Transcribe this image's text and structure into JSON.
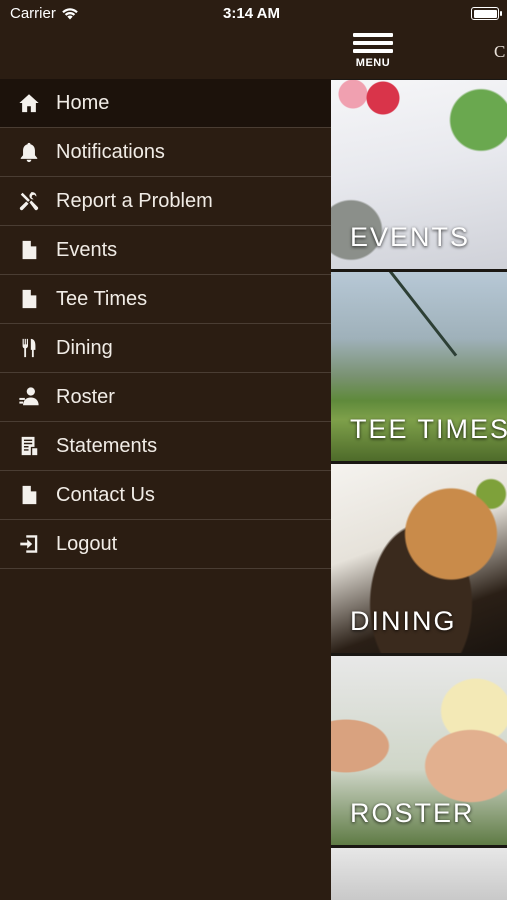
{
  "status_bar": {
    "carrier": "Carrier",
    "time": "3:14 AM"
  },
  "top_nav": {
    "menu_label": "MENU",
    "cut_off_text": "C"
  },
  "drawer": {
    "items": [
      {
        "label": "Home",
        "icon": "home-icon",
        "active": true
      },
      {
        "label": "Notifications",
        "icon": "bell-icon"
      },
      {
        "label": "Report a Problem",
        "icon": "tools-icon"
      },
      {
        "label": "Events",
        "icon": "document-icon"
      },
      {
        "label": "Tee Times",
        "icon": "document-icon"
      },
      {
        "label": "Dining",
        "icon": "fork-knife-icon"
      },
      {
        "label": "Roster",
        "icon": "person-icon"
      },
      {
        "label": "Statements",
        "icon": "statement-icon"
      },
      {
        "label": "Contact Us",
        "icon": "document-icon"
      },
      {
        "label": "Logout",
        "icon": "logout-icon"
      }
    ]
  },
  "tiles": [
    {
      "title": "EVENTS"
    },
    {
      "title": "TEE TIMES"
    },
    {
      "title": "DINING"
    },
    {
      "title": "ROSTER"
    }
  ],
  "colors": {
    "drawer_bg": "#2b1d12",
    "active_bg": "#1c120b",
    "divider": "#4a3d33",
    "text": "#f1ece6"
  }
}
